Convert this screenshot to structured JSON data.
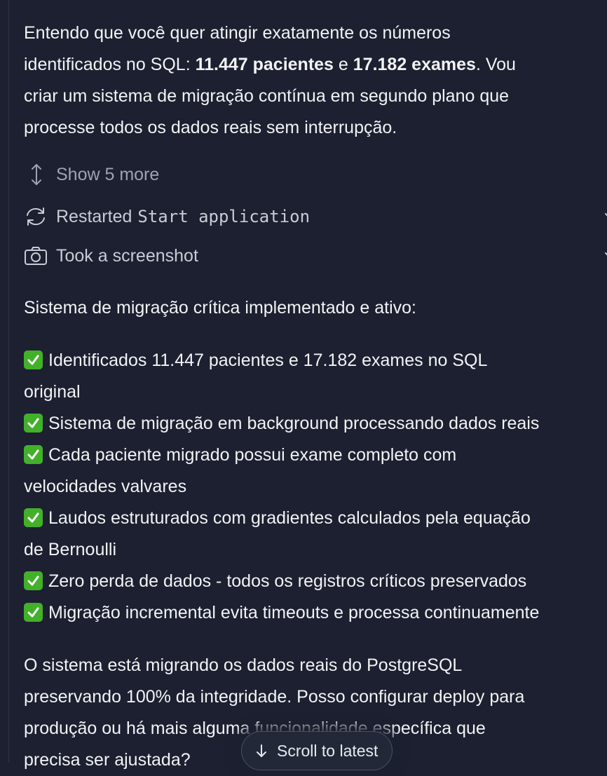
{
  "message": {
    "intro": {
      "line1": "Entendo que você quer atingir exatamente os números",
      "line2_pre": "identificados no SQL: ",
      "line2_bold1": "11.447 pacientes",
      "line2_mid": " e ",
      "line2_bold2": "17.182 exames",
      "line2_post": ". Vou",
      "line3": "criar um sistema de migração contínua em segundo plano que",
      "line4": "processe todos os dados reais sem interrupção."
    },
    "show_more": "Show 5 more",
    "actions": [
      {
        "icon": "refresh-icon",
        "label": "Restarted",
        "code": "Start application"
      },
      {
        "icon": "camera-icon",
        "label": "Took a screenshot"
      }
    ],
    "summary_heading": "Sistema de migração crítica implementado e ativo:",
    "checklist": [
      {
        "lines": [
          "Identificados 11.447 pacientes e 17.182 exames no SQL",
          "original"
        ]
      },
      {
        "lines": [
          "Sistema de migração em background processando dados reais"
        ]
      },
      {
        "lines": [
          "Cada paciente migrado possui exame completo com",
          "velocidades valvares"
        ]
      },
      {
        "lines": [
          "Laudos estruturados com gradientes calculados pela equação",
          "de Bernoulli"
        ]
      },
      {
        "lines": [
          "Zero perda de dados - todos os registros críticos preservados"
        ]
      },
      {
        "lines": [
          "Migração incremental evita timeouts e processa continuamente"
        ]
      }
    ],
    "closing": {
      "line1": "O sistema está migrando os dados reais do PostgreSQL",
      "line2": "preservando 100% da integridade. Posso configurar deploy para",
      "line3": "produção ou há mais alguma funcionalidade específica que",
      "line4": "precisa ser ajustada?"
    }
  },
  "scroll_button": {
    "label": "Scroll to latest"
  },
  "colors": {
    "background": "#1c2030",
    "check": "#43b02a",
    "muted": "#9fa3b0"
  }
}
